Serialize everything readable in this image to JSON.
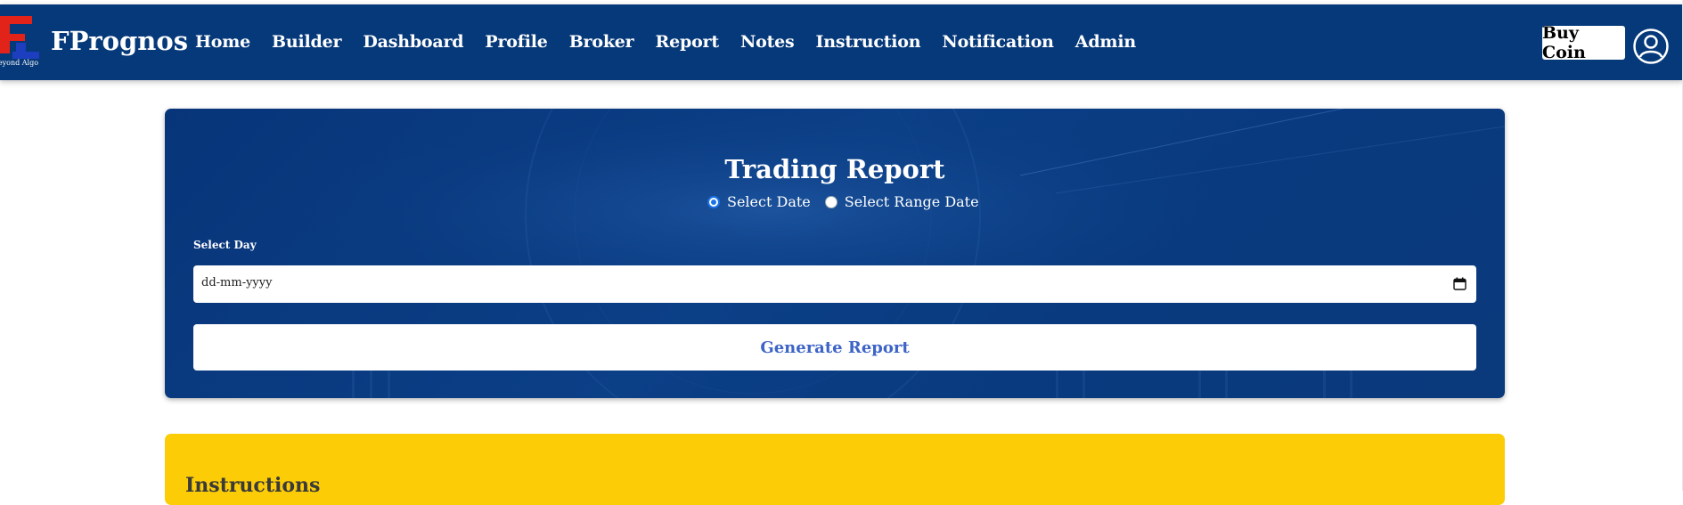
{
  "app": {
    "brand": "FPrognos",
    "logo_letter": "F",
    "tagline": "Beyond Algo"
  },
  "nav": {
    "items": [
      {
        "label": "Home"
      },
      {
        "label": "Builder"
      },
      {
        "label": "Dashboard"
      },
      {
        "label": "Profile"
      },
      {
        "label": "Broker"
      },
      {
        "label": "Report"
      },
      {
        "label": "Notes"
      },
      {
        "label": "Instruction"
      },
      {
        "label": "Notification"
      },
      {
        "label": "Admin"
      }
    ],
    "buy_coin_label": "Buy Coin",
    "avatar_icon": "user-circle-icon"
  },
  "report": {
    "title": "Trading Report",
    "mode_options": [
      {
        "label": "Select Date",
        "checked": true
      },
      {
        "label": "Select Range Date",
        "checked": false
      }
    ],
    "day_field_label": "Select Day",
    "date_placeholder": "dd-mm-yyyy",
    "calendar_icon": "calendar-icon",
    "generate_label": "Generate Report"
  },
  "instructions": {
    "title": "Instructions"
  },
  "colors": {
    "nav_bg": "#06397a",
    "card_bg": "#0b3f86",
    "accent_button_text": "#3d64c6",
    "instructions_bg": "#fccc07",
    "logo_red": "#e2231a",
    "logo_blue": "#1d3fbf"
  }
}
